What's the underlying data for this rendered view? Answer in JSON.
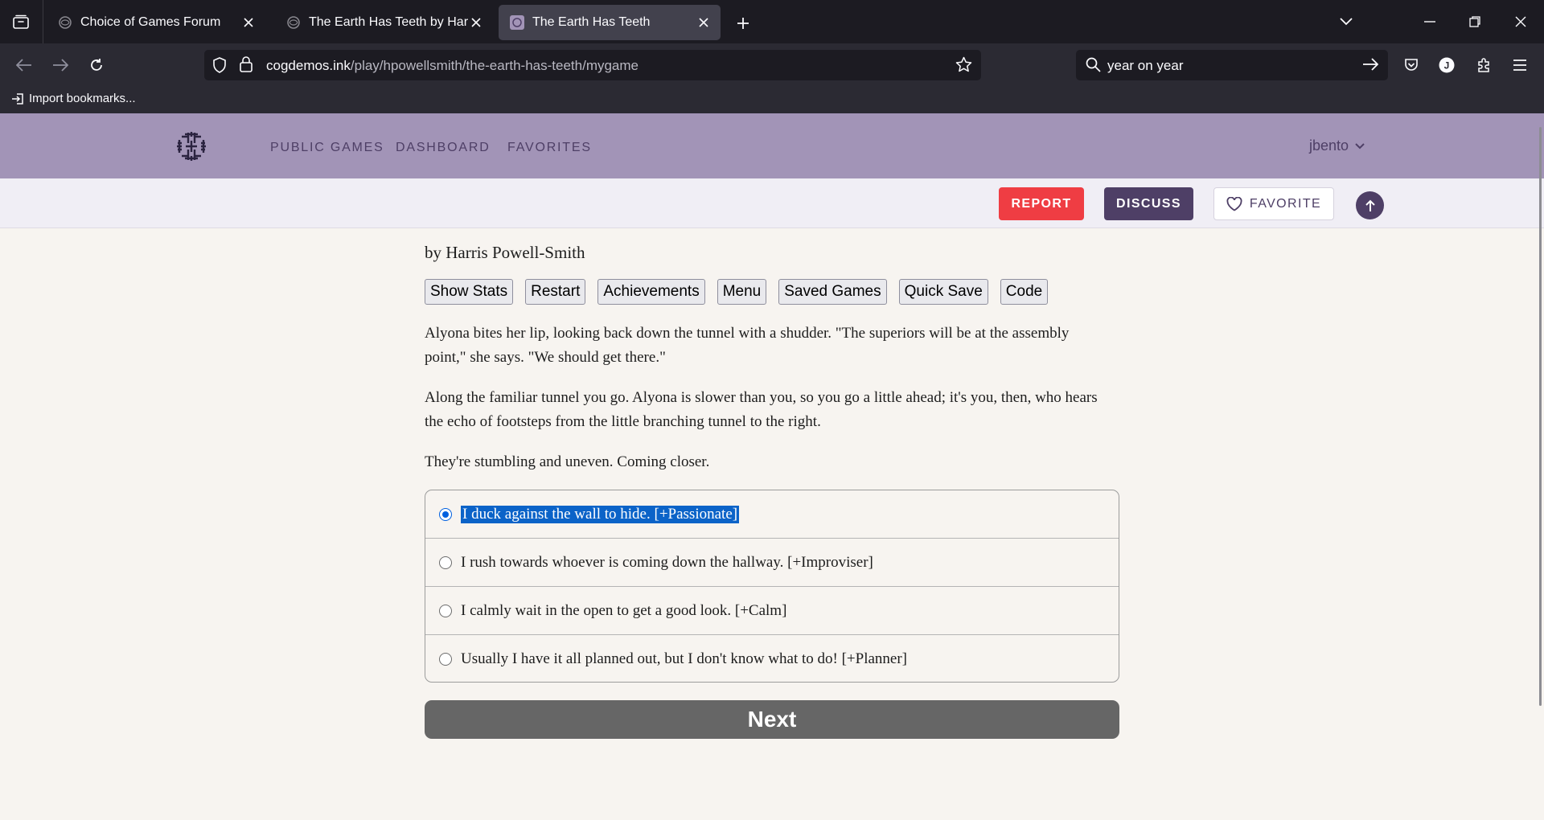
{
  "browser": {
    "tabs": [
      {
        "title": "Choice of Games Forum",
        "active": false
      },
      {
        "title": "The Earth Has Teeth by Harris Powell-Smith",
        "active": false
      },
      {
        "title": "The Earth Has Teeth",
        "active": true
      }
    ],
    "url_host": "cogdemos.ink",
    "url_path": "/play/hpowellsmith/the-earth-has-teeth/mygame",
    "search_text": "year on year",
    "bookmark_label": "Import bookmarks..."
  },
  "site": {
    "nav": [
      "PUBLIC GAMES",
      "DASHBOARD",
      "FAVORITES"
    ],
    "username": "jbento",
    "actions": {
      "report": "REPORT",
      "discuss": "DISCUSS",
      "favorite": "FAVORITE"
    },
    "colors": {
      "header": "#a294b7",
      "accent": "#4e3f66",
      "report": "#ef3d43"
    }
  },
  "game": {
    "byline": "by Harris Powell-Smith",
    "buttons": [
      "Show Stats",
      "Restart",
      "Achievements",
      "Menu",
      "Saved Games",
      "Quick Save",
      "Code"
    ],
    "paragraphs": [
      "Alyona bites her lip, looking back down the tunnel with a shudder. \"The superiors will be at the assembly point,\" she says. \"We should get there.\"",
      "Along the familiar tunnel you go. Alyona is slower than you, so you go a little ahead; it's you, then, who hears the echo of footsteps from the little branching tunnel to the right.",
      "They're stumbling and uneven. Coming closer."
    ],
    "choices": [
      {
        "label": "I duck against the wall to hide. [+Passionate]",
        "selected": true
      },
      {
        "label": "I rush towards whoever is coming down the hallway. [+Improviser]",
        "selected": false
      },
      {
        "label": "I calmly wait in the open to get a good look. [+Calm]",
        "selected": false
      },
      {
        "label": "Usually I have it all planned out, but I don't know what to do! [+Planner]",
        "selected": false
      }
    ],
    "next_label": "Next"
  }
}
